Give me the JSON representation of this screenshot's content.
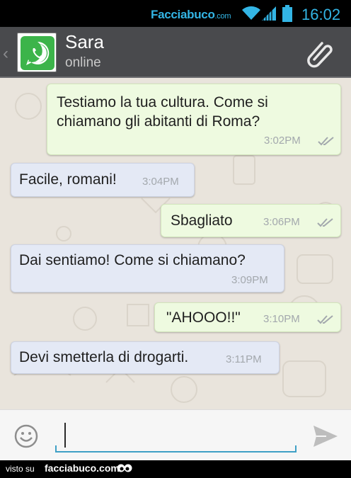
{
  "status_bar": {
    "brand": "Facciabuco",
    "brand_suffix": ".com",
    "time": "16:02",
    "accent_color": "#33b5e5"
  },
  "header": {
    "back_icon": "chevron-left-icon",
    "avatar_icon": "whatsapp-icon",
    "contact_name": "Sara",
    "contact_status": "online",
    "attach_icon": "paperclip-icon",
    "background_color": "#494a4d"
  },
  "messages": [
    {
      "direction": "outgoing",
      "line1": "Testiamo la tua cultura. Come si",
      "line2": "chiamano gli abitanti di Roma?",
      "time": "3:02PM",
      "status": "double-check"
    },
    {
      "direction": "incoming",
      "text": "Facile, romani!",
      "time": "3:04PM"
    },
    {
      "direction": "outgoing",
      "text": "Sbagliato",
      "time": "3:06PM",
      "status": "double-check"
    },
    {
      "direction": "incoming",
      "text": "Dai sentiamo! Come si chiamano?",
      "time": "3:09PM"
    },
    {
      "direction": "outgoing",
      "text": "\"AHOOO!!\"",
      "time": "3:10PM",
      "status": "double-check"
    },
    {
      "direction": "incoming",
      "text": "Devi smetterla di drogarti.",
      "time": "3:11PM"
    }
  ],
  "colors": {
    "outgoing_bubble": "#eefae0",
    "incoming_bubble": "#e4e9f5",
    "chat_background": "#e9e4dc"
  },
  "input_bar": {
    "emoji_icon": "smiley-icon",
    "value": "",
    "send_icon": "send-icon"
  },
  "footer": {
    "visto_label": "visto su",
    "site": "facciabuco.com"
  }
}
